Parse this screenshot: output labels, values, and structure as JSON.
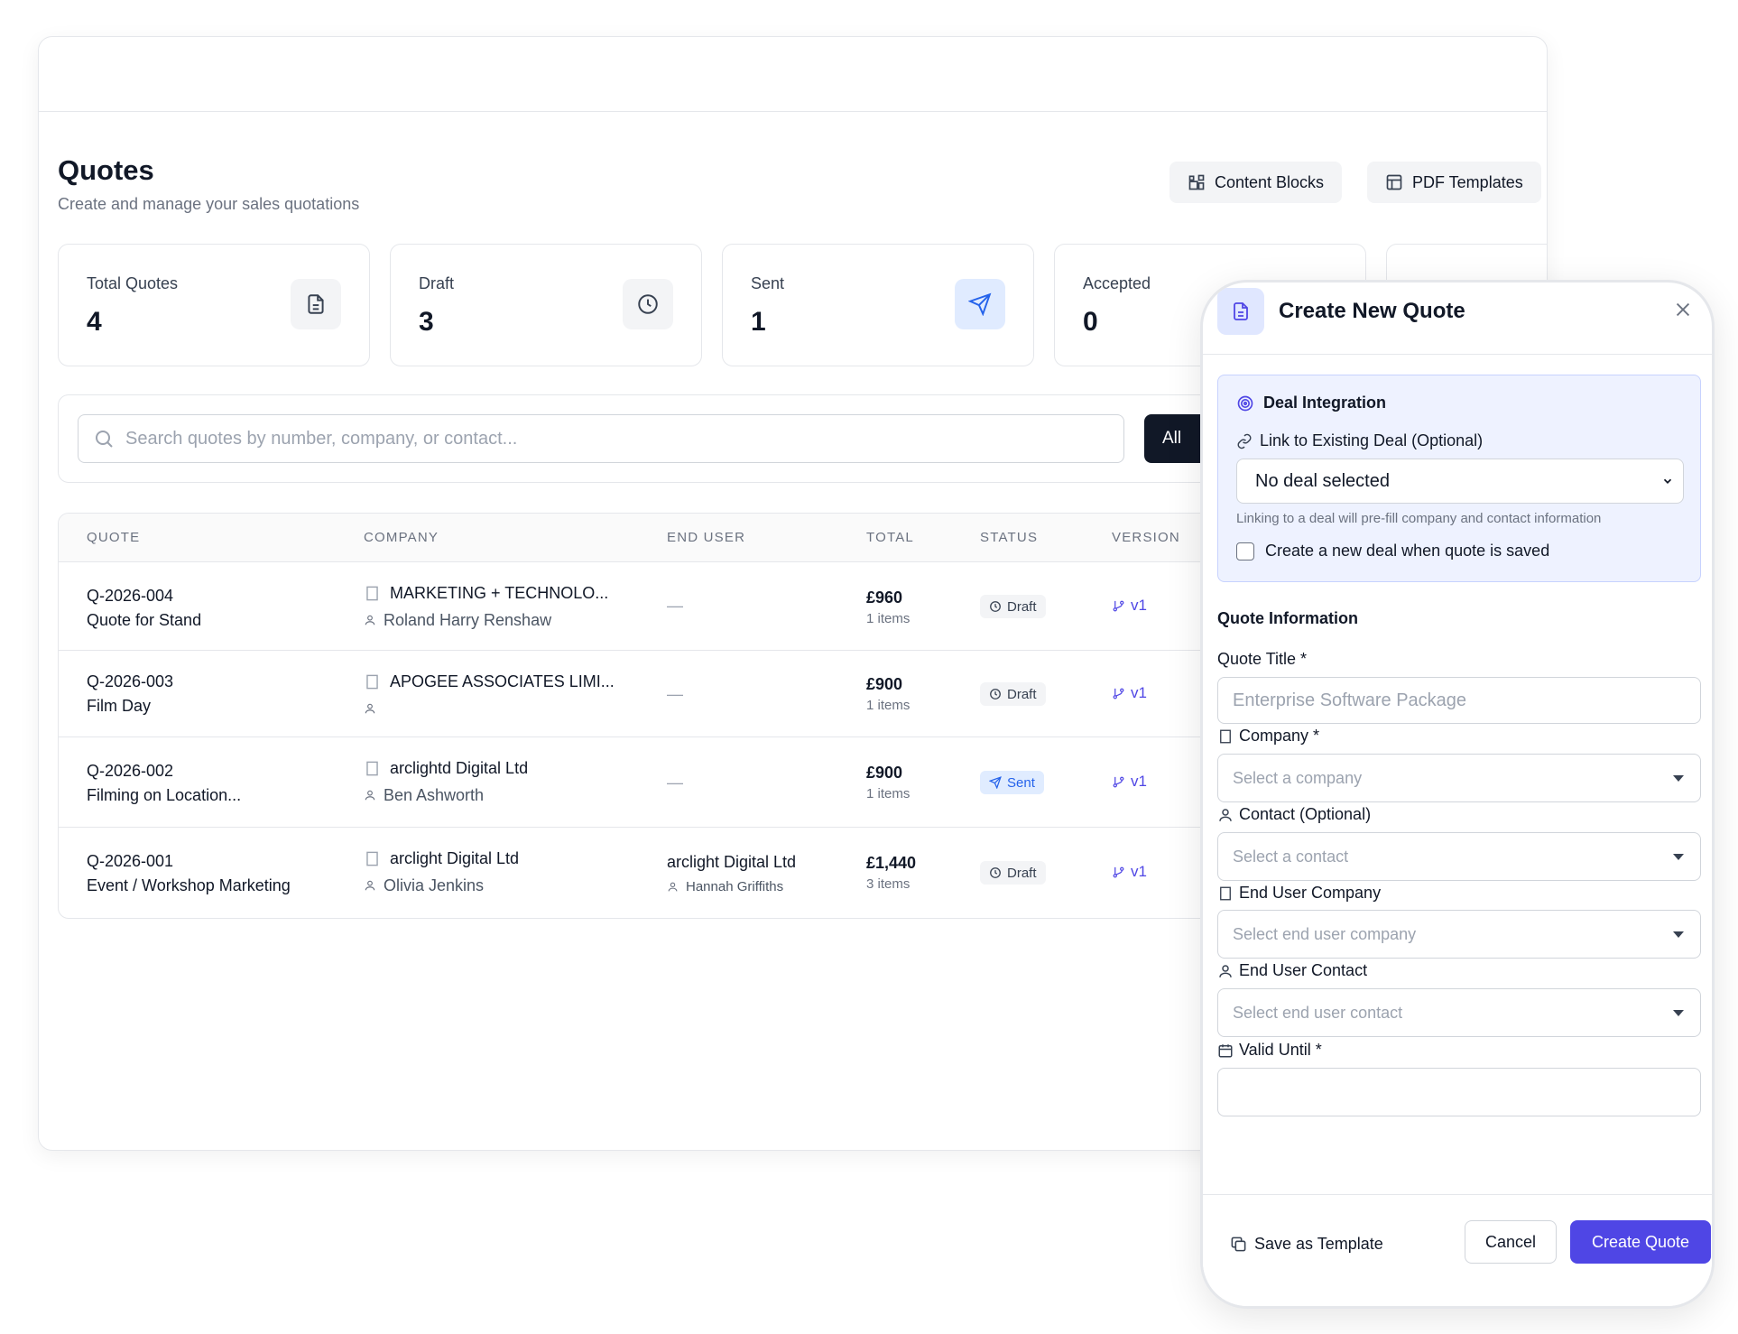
{
  "page": {
    "title": "Quotes",
    "subtitle": "Create and manage your sales quotations",
    "buttons": {
      "content_blocks": "Content Blocks",
      "pdf_templates": "PDF Templates"
    }
  },
  "stats": [
    {
      "label": "Total Quotes",
      "value": "4",
      "icon": "document-icon"
    },
    {
      "label": "Draft",
      "value": "3",
      "icon": "clock-icon"
    },
    {
      "label": "Sent",
      "value": "1",
      "icon": "send-icon"
    },
    {
      "label": "Accepted",
      "value": "0",
      "icon": "check-icon"
    }
  ],
  "search": {
    "placeholder": "Search quotes by number, company, or contact...",
    "filter_label": "All"
  },
  "table": {
    "headers": {
      "quote": "QUOTE",
      "company": "COMPANY",
      "end_user": "END USER",
      "total": "TOTAL",
      "status": "STATUS",
      "version": "VERSION"
    },
    "rows": [
      {
        "number": "Q-2026-004",
        "title": "Quote for Stand",
        "company": "MARKETING + TECHNOLO...",
        "contact": "Roland Harry Renshaw",
        "end_user": "—",
        "end_user_contact": "",
        "total": "£960",
        "items": "1 items",
        "status": "Draft",
        "version": "v1"
      },
      {
        "number": "Q-2026-003",
        "title": "Film Day",
        "company": "APOGEE ASSOCIATES LIMI...",
        "contact": "",
        "end_user": "—",
        "end_user_contact": "",
        "total": "£900",
        "items": "1 items",
        "status": "Draft",
        "version": "v1"
      },
      {
        "number": "Q-2026-002",
        "title": "Filming on Location...",
        "company": "arclightd Digital Ltd",
        "contact": "Ben Ashworth",
        "end_user": "—",
        "end_user_contact": "",
        "total": "£900",
        "items": "1 items",
        "status": "Sent",
        "version": "v1"
      },
      {
        "number": "Q-2026-001",
        "title": "Event / Workshop Marketing",
        "company": "arclight Digital Ltd",
        "contact": "Olivia Jenkins",
        "end_user": "arclight Digital Ltd",
        "end_user_contact": "Hannah Griffiths",
        "total": "£1,440",
        "items": "3 items",
        "status": "Draft",
        "version": "v1"
      }
    ]
  },
  "modal": {
    "title": "Create New Quote",
    "deal": {
      "heading": "Deal Integration",
      "link_label": "Link to Existing Deal (Optional)",
      "selected": "No deal selected",
      "hint": "Linking to a deal will pre-fill company and contact information",
      "checkbox_label": "Create a new deal when quote is saved"
    },
    "section_title": "Quote Information",
    "fields": {
      "quote_title_label": "Quote Title *",
      "quote_title_placeholder": "Enterprise Software Package",
      "company_label": "Company *",
      "company_placeholder": "Select a company",
      "contact_label": "Contact (Optional)",
      "contact_placeholder": "Select a contact",
      "end_user_company_label": "End User Company",
      "end_user_company_placeholder": "Select end user company",
      "end_user_contact_label": "End User Contact",
      "end_user_contact_placeholder": "Select end user contact",
      "valid_until_label": "Valid Until *"
    },
    "footer": {
      "save_template": "Save as Template",
      "cancel": "Cancel",
      "create": "Create Quote"
    }
  },
  "colors": {
    "accent": "#4f46e5",
    "sent_badge": "#2563eb",
    "dark_button": "#111827",
    "deal_panel": "#eef2ff"
  }
}
